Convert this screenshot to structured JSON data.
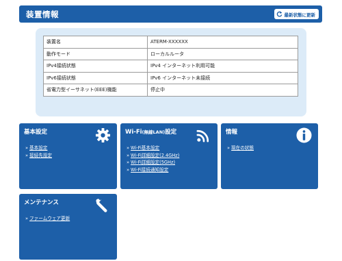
{
  "header": {
    "title": "装置情報",
    "refresh_label": "最新状態に更新"
  },
  "device_info": [
    {
      "key": "装置名",
      "value": "ATERM-XXXXXX"
    },
    {
      "key": "動作モード",
      "value": "ローカルルータ"
    },
    {
      "key": "IPv4接続状態",
      "value": "IPv4 インターネット利用可能"
    },
    {
      "key": "IPv6接続状態",
      "value": "IPv6 インターネット未接続"
    },
    {
      "key": "省電力型イーサネット(EEE)機能",
      "value": "停止中"
    }
  ],
  "cards": {
    "basic": {
      "title": "基本設定",
      "icon": "gear-icon",
      "links": [
        "基本設定",
        "接続先設定"
      ]
    },
    "wifi": {
      "title_main": "Wi-Fi",
      "title_small": "(無線LAN)",
      "title_end": "設定",
      "icon": "wifi-icon",
      "links": [
        "Wi-Fi基本設定",
        "Wi-Fi詳細設定(2.4GHz)",
        "Wi-Fi詳細設定(5GHz)",
        "Wi-Fi接続通知設定"
      ]
    },
    "info": {
      "title": "情報",
      "icon": "info-icon",
      "links": [
        "現在の状態"
      ]
    },
    "maintenance": {
      "title": "メンテナンス",
      "icon": "wrench-icon",
      "links": [
        "ファームウェア更新"
      ]
    }
  },
  "colors": {
    "accent": "#1d5fa8",
    "panel": "#dcebf8"
  },
  "bullet": "»"
}
